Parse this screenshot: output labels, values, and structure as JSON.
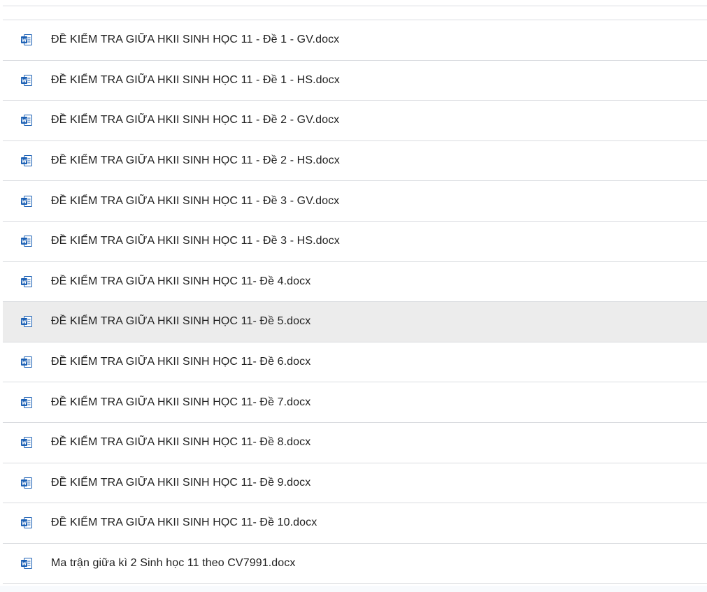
{
  "colors": {
    "word_blue": "#1a5fb4",
    "divider": "#dadce0",
    "selected_row": "#ececec",
    "text": "#1f1f1f"
  },
  "files": [
    {
      "name": "ĐỀ KIỂM TRA GIỮA HKII SINH HỌC 11 - Đề 1 - GV.docx",
      "icon": "word-doc-icon"
    },
    {
      "name": "ĐỀ KIỂM TRA GIỮA HKII SINH HỌC 11 - Đề 1 - HS.docx",
      "icon": "word-doc-icon"
    },
    {
      "name": "ĐỀ KIỂM TRA GIỮA HKII SINH HỌC 11 - Đề 2 - GV.docx",
      "icon": "word-doc-icon"
    },
    {
      "name": "ĐỀ KIỂM TRA GIỮA HKII SINH HỌC 11 - Đề 2 - HS.docx",
      "icon": "word-doc-icon"
    },
    {
      "name": "ĐỀ KIỂM TRA GIỮA HKII SINH HỌC 11 - Đề 3 - GV.docx",
      "icon": "word-doc-icon"
    },
    {
      "name": "ĐỀ KIỂM TRA GIỮA HKII SINH HỌC 11 - Đề 3 - HS.docx",
      "icon": "word-doc-icon"
    },
    {
      "name": "ĐỀ KIỂM TRA GIỮA HKII SINH HỌC 11- Đề 4.docx",
      "icon": "word-doc-icon"
    },
    {
      "name": "ĐỀ KIỂM TRA GIỮA HKII SINH HỌC 11- Đề 5.docx",
      "icon": "word-doc-icon",
      "selected": true
    },
    {
      "name": "ĐỀ KIỂM TRA GIỮA HKII SINH HỌC 11- Đề 6.docx",
      "icon": "word-doc-icon"
    },
    {
      "name": "ĐỀ KIỂM TRA GIỮA HKII SINH HỌC 11- Đề 7.docx",
      "icon": "word-doc-icon"
    },
    {
      "name": "ĐỀ KIỂM TRA GIỮA HKII SINH HỌC 11- Đề 8.docx",
      "icon": "word-doc-icon"
    },
    {
      "name": "ĐỀ KIỂM TRA GIỮA HKII SINH HỌC 11- Đề 9.docx",
      "icon": "word-doc-icon"
    },
    {
      "name": "ĐỀ KIỂM TRA GIỮA HKII SINH HỌC 11- Đề 10.docx",
      "icon": "word-doc-icon"
    },
    {
      "name": "Ma trận giữa kì 2 Sinh học 11 theo CV7991.docx",
      "icon": "word-doc-icon"
    }
  ]
}
